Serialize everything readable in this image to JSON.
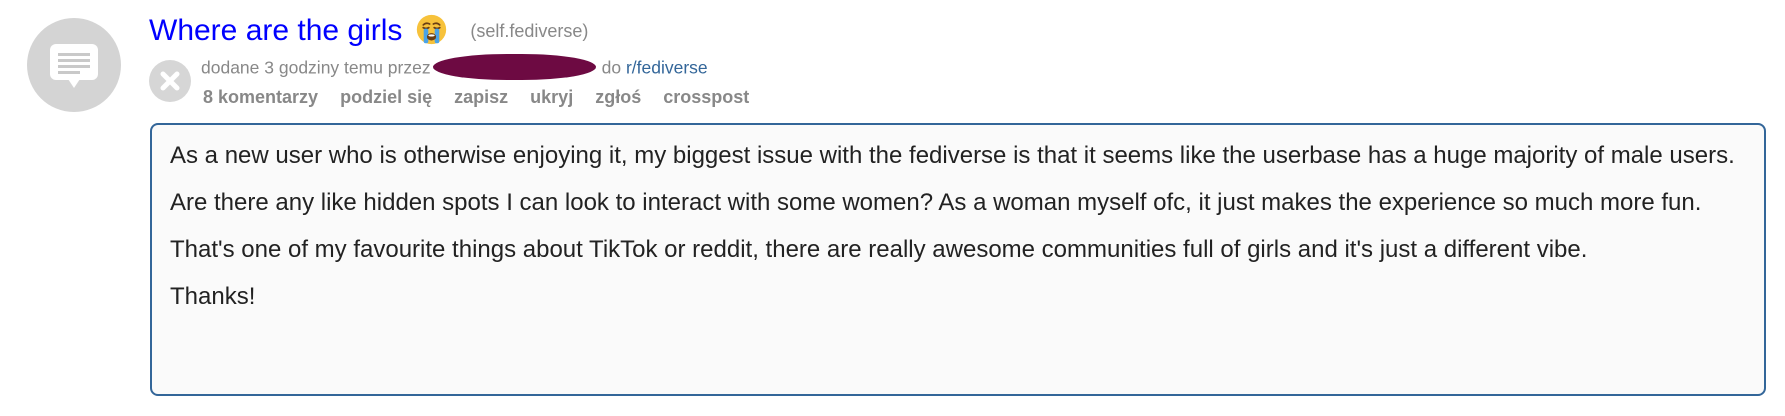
{
  "post": {
    "title": "Where are the girls",
    "title_emoji": "loudly-crying-face",
    "domain": "(self.fediverse)",
    "tagline": {
      "prefix": "dodane 3 godziny temu przez",
      "author_redacted": true,
      "to": "do",
      "subreddit": "r/fediverse"
    },
    "buttons": {
      "comments": "8 komentarzy",
      "share": "podziel się",
      "save": "zapisz",
      "hide": "ukryj",
      "report": "zgłoś",
      "crosspost": "crosspost"
    },
    "body": [
      "As a new user who is otherwise enjoying it, my biggest issue with the fediverse is that it seems like the userbase has a huge majority of male users.",
      "Are there any like hidden spots I can look to interact with some women? As a woman myself ofc, it just makes the experience so much more fun.",
      "That's one of my favourite things about TikTok or reddit, there are really awesome communities full of girls and it's just a different vibe.",
      "Thanks!"
    ]
  },
  "icons": {
    "thumbnail": "self-post-icon",
    "expando": "close-icon"
  },
  "colors": {
    "title": "#0000ff",
    "muted": "#888888",
    "link": "#336699",
    "redaction": "#6d0a42",
    "border": "#336699"
  }
}
